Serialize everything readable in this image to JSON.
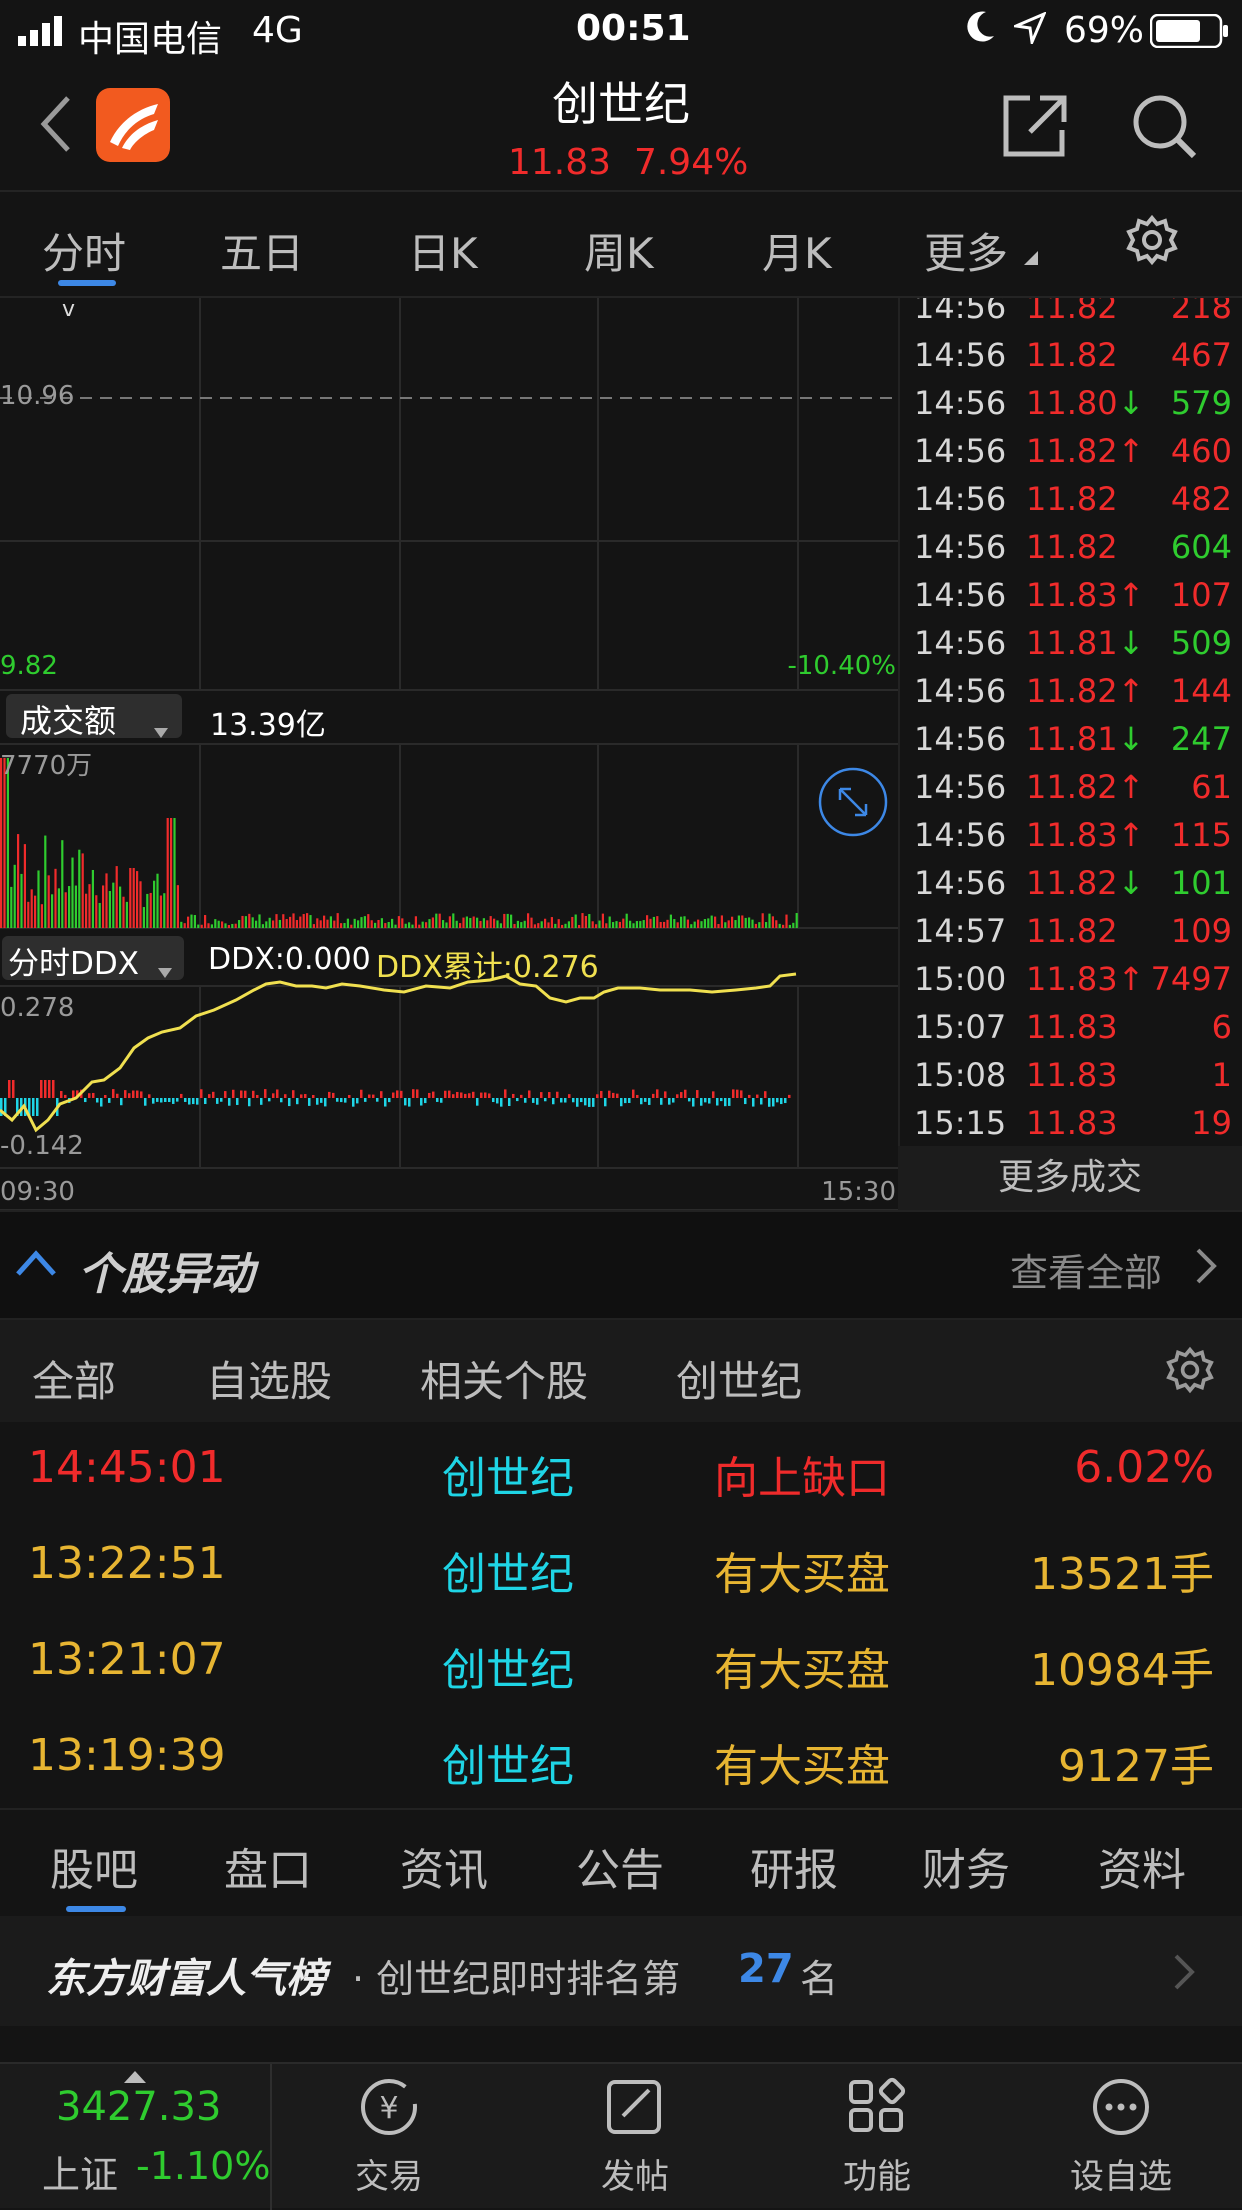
{
  "status": {
    "carrier": "中国电信",
    "network": "4G",
    "time": "00:51",
    "battery": "69%"
  },
  "header": {
    "title": "创世纪",
    "price": "11.83",
    "change": "7.94%"
  },
  "tabs": [
    "分时",
    "五日",
    "日K",
    "周K",
    "月K",
    "更多"
  ],
  "chart": {
    "price_line_label": "10.96",
    "low_label": "9.82",
    "low_pct": "-10.40%",
    "volume_selector": "成交额",
    "volume_total": "13.39亿",
    "volume_max": "7770万",
    "ddx_selector": "分时DDX",
    "ddx_value": "DDX:0.000",
    "ddx_cum": "DDX累计:0.276",
    "ddx_max": "0.278",
    "ddx_min": "-0.142",
    "time_start": "09:30",
    "time_end": "15:30"
  },
  "ticks": [
    {
      "t": "14:56",
      "p": "11.82",
      "a": "",
      "v": "218",
      "pc": "red",
      "vc": "red"
    },
    {
      "t": "14:56",
      "p": "11.82",
      "a": "",
      "v": "467",
      "pc": "red",
      "vc": "red"
    },
    {
      "t": "14:56",
      "p": "11.80",
      "a": "↓",
      "v": "579",
      "pc": "red",
      "vc": "green"
    },
    {
      "t": "14:56",
      "p": "11.82",
      "a": "↑",
      "v": "460",
      "pc": "red",
      "vc": "red"
    },
    {
      "t": "14:56",
      "p": "11.82",
      "a": "",
      "v": "482",
      "pc": "red",
      "vc": "red"
    },
    {
      "t": "14:56",
      "p": "11.82",
      "a": "",
      "v": "604",
      "pc": "red",
      "vc": "green"
    },
    {
      "t": "14:56",
      "p": "11.83",
      "a": "↑",
      "v": "107",
      "pc": "red",
      "vc": "red"
    },
    {
      "t": "14:56",
      "p": "11.81",
      "a": "↓",
      "v": "509",
      "pc": "red",
      "vc": "green"
    },
    {
      "t": "14:56",
      "p": "11.82",
      "a": "↑",
      "v": "144",
      "pc": "red",
      "vc": "red"
    },
    {
      "t": "14:56",
      "p": "11.81",
      "a": "↓",
      "v": "247",
      "pc": "red",
      "vc": "green"
    },
    {
      "t": "14:56",
      "p": "11.82",
      "a": "↑",
      "v": "61",
      "pc": "red",
      "vc": "red"
    },
    {
      "t": "14:56",
      "p": "11.83",
      "a": "↑",
      "v": "115",
      "pc": "red",
      "vc": "red"
    },
    {
      "t": "14:56",
      "p": "11.82",
      "a": "↓",
      "v": "101",
      "pc": "red",
      "vc": "green"
    },
    {
      "t": "14:57",
      "p": "11.82",
      "a": "",
      "v": "109",
      "pc": "red",
      "vc": "red"
    },
    {
      "t": "15:00",
      "p": "11.83",
      "a": "↑",
      "v": "7497",
      "pc": "red",
      "vc": "red"
    },
    {
      "t": "15:07",
      "p": "11.83",
      "a": "",
      "v": "6",
      "pc": "red",
      "vc": "red"
    },
    {
      "t": "15:08",
      "p": "11.83",
      "a": "",
      "v": "1",
      "pc": "red",
      "vc": "red"
    },
    {
      "t": "15:15",
      "p": "11.83",
      "a": "",
      "v": "19",
      "pc": "red",
      "vc": "red"
    }
  ],
  "more_deals": "更多成交",
  "movers": {
    "title": "个股异动",
    "view_all": "查看全部"
  },
  "filters": [
    "全部",
    "自选股",
    "相关个股",
    "创世纪"
  ],
  "events": [
    {
      "time": "14:45:01",
      "name": "创世纪",
      "type": "向上缺口",
      "value": "6.02%",
      "color": "red"
    },
    {
      "time": "13:22:51",
      "name": "创世纪",
      "type": "有大买盘",
      "value": "13521手",
      "color": "yellow"
    },
    {
      "time": "13:21:07",
      "name": "创世纪",
      "type": "有大买盘",
      "value": "10984手",
      "color": "yellow"
    },
    {
      "time": "13:19:39",
      "name": "创世纪",
      "type": "有大买盘",
      "value": "9127手",
      "color": "yellow"
    }
  ],
  "bottom_tabs": [
    "股吧",
    "盘口",
    "资讯",
    "公告",
    "研报",
    "财务",
    "资料"
  ],
  "rank": {
    "brand": "东方财富人气榜",
    "text": "· 创世纪即时排名第",
    "rank": "27",
    "suffix": "名"
  },
  "footer": {
    "index_value": "3427.33",
    "index_name": "上证",
    "index_change": "-1.10%",
    "items": [
      "交易",
      "发帖",
      "功能",
      "设自选"
    ]
  }
}
